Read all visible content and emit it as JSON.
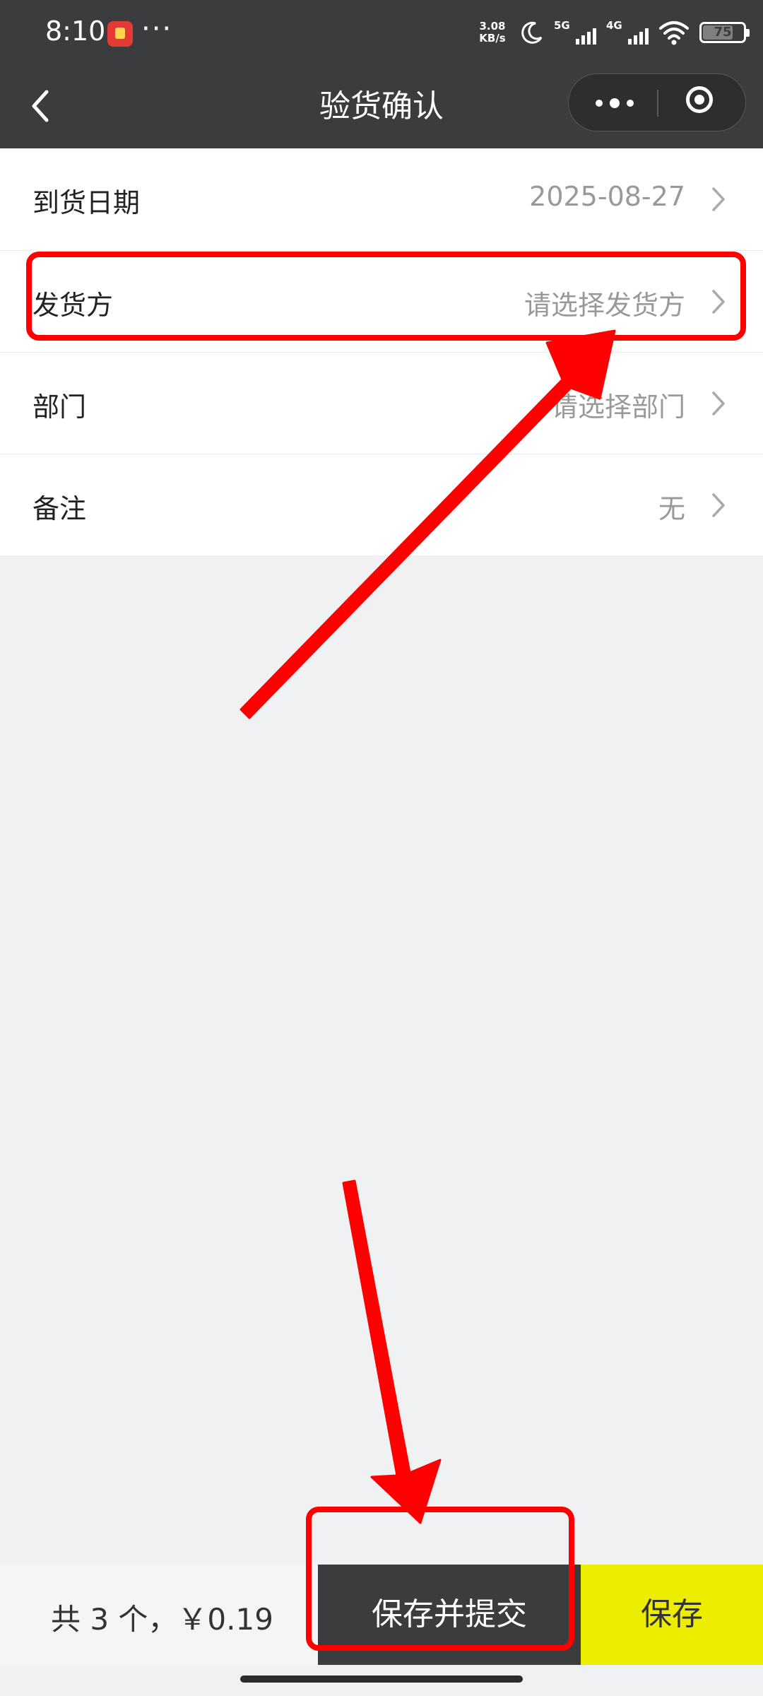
{
  "status_bar": {
    "time": "8:10",
    "more": "···",
    "net_speed_value": "3.08",
    "net_speed_unit": "KB/s",
    "sim1_label": "5G",
    "sim2_label": "4G",
    "battery_level": "75",
    "battery_fraction": 0.75
  },
  "nav": {
    "title": "验货确认"
  },
  "form": {
    "rows": [
      {
        "label": "到货日期",
        "value": "2025-08-27"
      },
      {
        "label": "发货方",
        "value": "请选择发货方"
      },
      {
        "label": "部门",
        "value": "请选择部门"
      },
      {
        "label": "备注",
        "value": "无"
      }
    ]
  },
  "bottom": {
    "total": "共 3 个，￥0.19",
    "submit_label": "保存并提交",
    "save_label": "保存"
  },
  "colors": {
    "header_bg": "#3a3c3e",
    "accent_yellow": "#eded00",
    "annotation_red": "#ff0000"
  }
}
